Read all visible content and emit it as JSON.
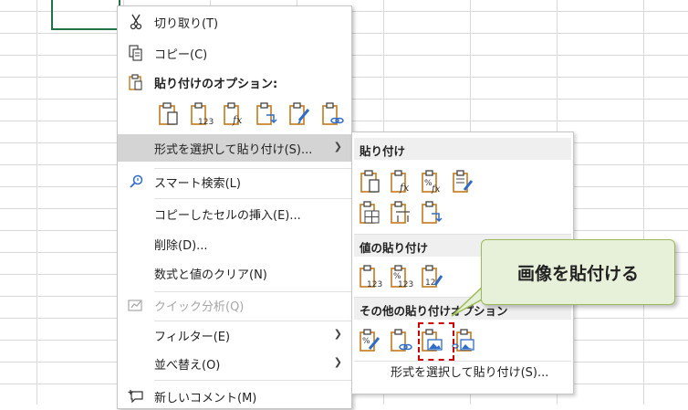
{
  "context_menu": {
    "cut": "切り取り(T)",
    "copy": "コピー(C)",
    "paste_options": "貼り付けのオプション:",
    "paste_special": "形式を選択して貼り付け(S)...",
    "smart_lookup": "スマート検索(L)",
    "insert_copied": "コピーしたセルの挿入(E)...",
    "delete": "削除(D)...",
    "clear_contents": "数式と値のクリア(N)",
    "quick_analysis": "クイック分析(Q)",
    "filter": "フィルター(E)",
    "sort": "並べ替え(O)",
    "new_comment": "新しいコメント(M)"
  },
  "submenu": {
    "paste_header": "貼り付け",
    "values_header": "値の貼り付け",
    "other_header": "その他の貼り付けオプション",
    "footer": "形式を選択して貼り付け(S)..."
  },
  "callout": {
    "text": "画像を貼付ける"
  },
  "colors": {
    "accent": "#217346",
    "clipboard": "#c57a1a",
    "highlight": "#d00000",
    "callout_bg": "#e7f0d9",
    "callout_border": "#9bbb59"
  },
  "icons": {
    "paste_row": [
      "paste-icon",
      "paste-values-123-icon",
      "paste-formulas-fx-icon",
      "paste-transpose-icon",
      "paste-formatting-icon",
      "paste-link-icon"
    ],
    "sub_paste_row1": [
      "paste-icon",
      "paste-formulas-fx-icon",
      "paste-formulas-number-format-icon",
      "paste-keep-source-format-icon"
    ],
    "sub_paste_row2": [
      "paste-no-borders-icon",
      "paste-keep-column-widths-icon",
      "paste-transpose-icon"
    ],
    "sub_values_row": [
      "paste-values-123-icon",
      "paste-values-number-format-icon",
      "paste-values-source-format-icon"
    ],
    "sub_other_row": [
      "paste-formatting-icon",
      "paste-link-icon",
      "paste-picture-icon",
      "paste-linked-picture-icon"
    ]
  }
}
